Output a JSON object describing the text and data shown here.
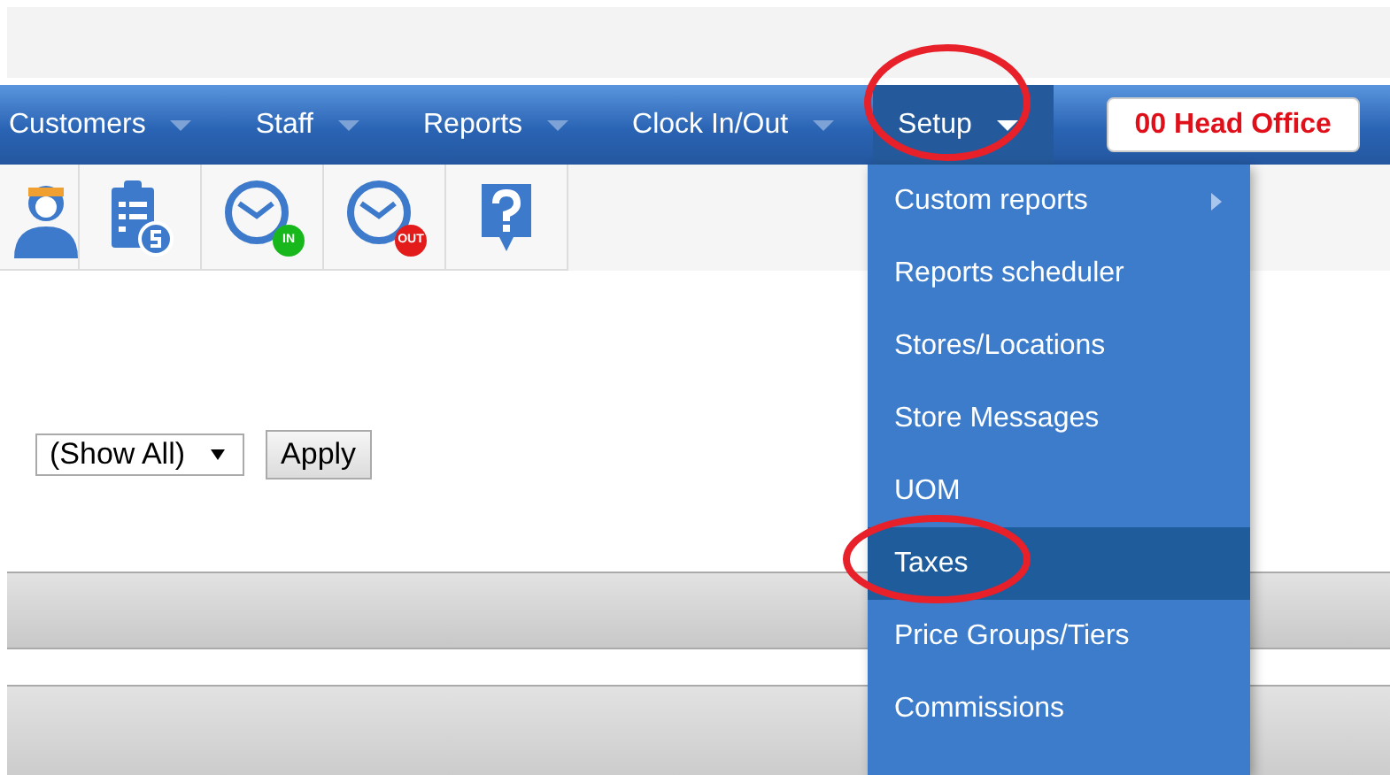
{
  "nav": {
    "items": [
      {
        "label": "Customers",
        "selected": false
      },
      {
        "label": "Staff",
        "selected": false
      },
      {
        "label": "Reports",
        "selected": false
      },
      {
        "label": "Clock In/Out",
        "selected": false
      },
      {
        "label": "Setup",
        "selected": true
      }
    ],
    "store_button": "00 Head Office"
  },
  "toolbar": [
    {
      "kind": "person"
    },
    {
      "kind": "clipboard"
    },
    {
      "kind": "clock-in",
      "badge": "IN"
    },
    {
      "kind": "clock-out",
      "badge": "OUT"
    },
    {
      "kind": "help"
    }
  ],
  "filter": {
    "select_value": "(Show All)",
    "apply": "Apply"
  },
  "menu": [
    {
      "label": "Custom reports",
      "submenu": true,
      "selected": false
    },
    {
      "label": "Reports scheduler",
      "submenu": false,
      "selected": false
    },
    {
      "label": "Stores/Locations",
      "submenu": false,
      "selected": false
    },
    {
      "label": "Store Messages",
      "submenu": false,
      "selected": false
    },
    {
      "label": "UOM",
      "submenu": false,
      "selected": false
    },
    {
      "label": "Taxes",
      "submenu": false,
      "selected": true
    },
    {
      "label": "Price Groups/Tiers",
      "submenu": false,
      "selected": false
    },
    {
      "label": "Commissions",
      "submenu": false,
      "selected": false
    }
  ]
}
